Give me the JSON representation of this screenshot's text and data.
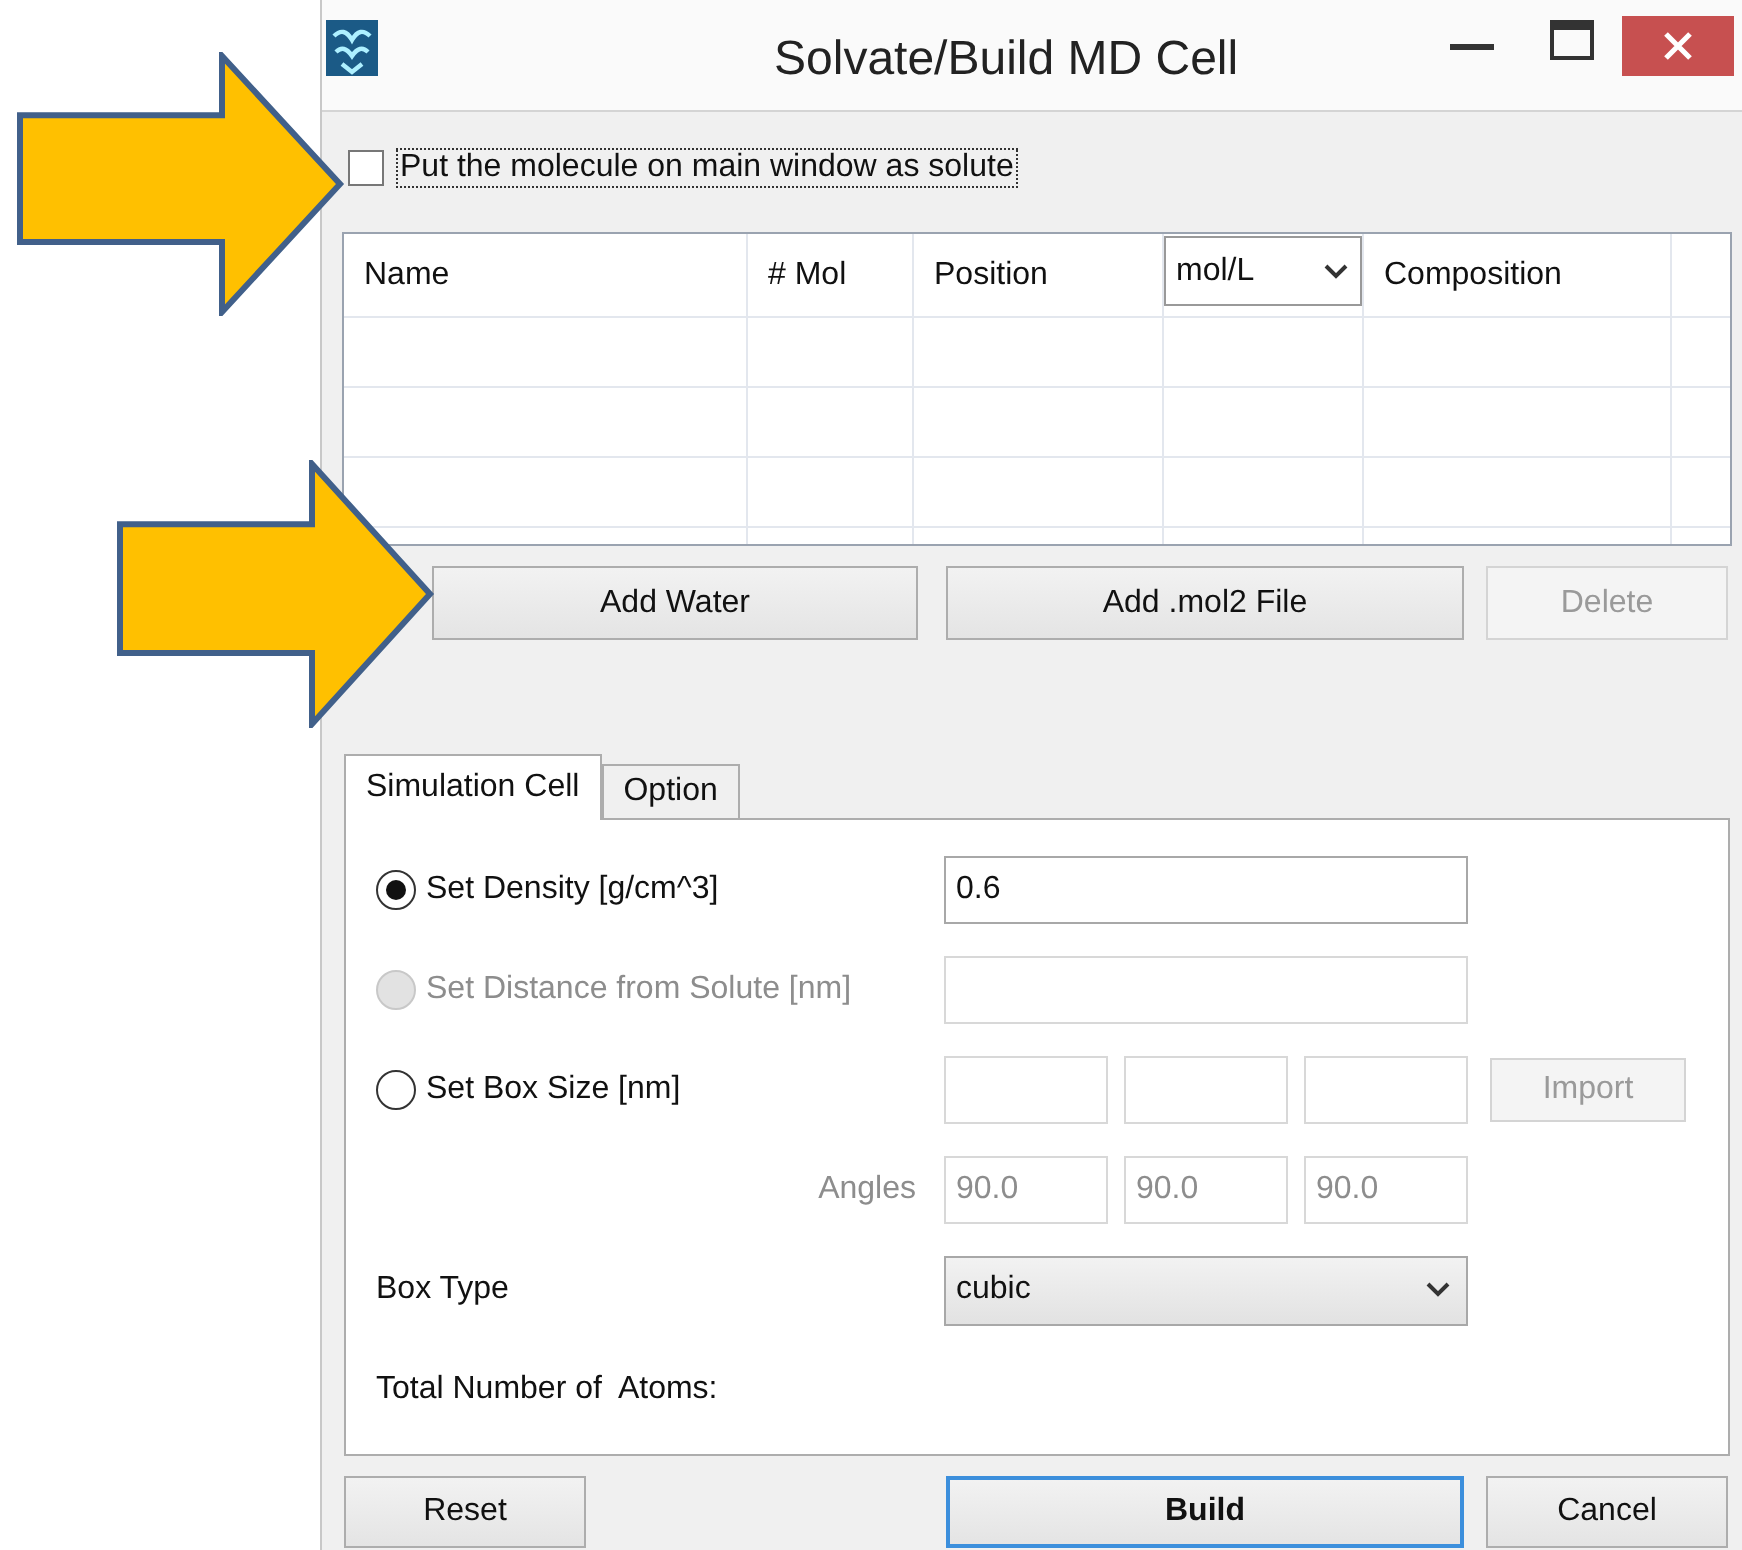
{
  "window": {
    "title": "Solvate/Build MD Cell"
  },
  "solute_checkbox": {
    "label": "Put the molecule on main window as solute",
    "checked": false,
    "focused": true
  },
  "molecule_table": {
    "columns": [
      {
        "kind": "text",
        "label": "Name"
      },
      {
        "kind": "text",
        "label": "# Mol"
      },
      {
        "kind": "text",
        "label": "Position"
      },
      {
        "kind": "dropdown",
        "label": "mol/L"
      },
      {
        "kind": "text",
        "label": "Composition"
      }
    ]
  },
  "molecule_buttons": [
    {
      "label": "Add Water",
      "disabled": false
    },
    {
      "label": "Add .mol2 File",
      "disabled": false
    },
    {
      "label": "Delete",
      "disabled": true
    }
  ],
  "tabs": [
    {
      "label": "Simulation Cell",
      "selected": true
    },
    {
      "label": "Option",
      "selected": false
    }
  ],
  "options": [
    {
      "kind": "radio",
      "label": "Set Density [g/cm^3]",
      "selected": true,
      "disabled": false,
      "fields": [
        {
          "value": "0.6",
          "disabled": false
        }
      ]
    },
    {
      "kind": "radio",
      "label": "Set Distance from Solute [nm]",
      "selected": false,
      "disabled": true,
      "fields": [
        {
          "disabled": true
        }
      ]
    },
    {
      "kind": "radio",
      "label": "Set Box Size [nm]",
      "selected": false,
      "disabled": false,
      "fields": [
        {
          "disabled": true
        },
        {
          "disabled": true
        },
        {
          "disabled": true
        }
      ],
      "button": {
        "label": "Import",
        "disabled": true
      }
    },
    {
      "kind": "angles",
      "label": "Angles",
      "disabled": true,
      "fields": [
        {
          "value": "90.0",
          "disabled": true
        },
        {
          "value": "90.0",
          "disabled": true
        },
        {
          "value": "90.0",
          "disabled": true
        }
      ]
    },
    {
      "kind": "select",
      "label": "Box Type",
      "value": "cubic"
    },
    {
      "kind": "info",
      "label": "Total Number of  Atoms:"
    }
  ],
  "bottom_buttons": [
    {
      "label": "Reset",
      "default": false
    },
    {
      "label": "Build",
      "default": true
    },
    {
      "label": "Cancel",
      "default": false
    }
  ],
  "callouts": [
    {
      "kind": "arrow"
    },
    {
      "kind": "arrow"
    }
  ]
}
